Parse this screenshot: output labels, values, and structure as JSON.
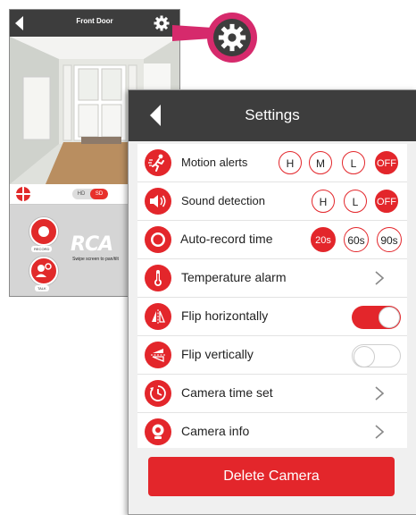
{
  "phone": {
    "title": "Front Door",
    "quality_hd": "HD",
    "quality_sd": "SD",
    "record_label": "RECORD",
    "talk_label": "TALK",
    "brand": "RCA",
    "swipe_hint": "Swipe screen to pan/tilt"
  },
  "settings": {
    "title": "Settings",
    "rows": [
      {
        "label": "Motion alerts",
        "icon": "running-person-icon",
        "options": [
          "H",
          "M",
          "L",
          "OFF"
        ],
        "selected": "OFF"
      },
      {
        "label": "Sound detection",
        "icon": "speaker-icon",
        "options": [
          "H",
          "L",
          "OFF"
        ],
        "selected": "OFF"
      },
      {
        "label": "Auto-record time",
        "icon": "record-icon",
        "options": [
          "20s",
          "60s",
          "90s"
        ],
        "selected": "20s"
      },
      {
        "label": "Temperature alarm",
        "icon": "thermometer-icon"
      },
      {
        "label": "Flip horizontally",
        "icon": "flip-horizontal-icon",
        "toggle": true
      },
      {
        "label": "Flip vertically",
        "icon": "flip-vertical-icon",
        "toggle": false
      },
      {
        "label": "Camera time set",
        "icon": "clock-icon"
      },
      {
        "label": "Camera info",
        "icon": "camera-info-icon"
      }
    ],
    "delete_label": "Delete Camera"
  },
  "colors": {
    "accent_red": "#e3262b",
    "header_dark": "#3d3d3d",
    "callout_pink": "#d62a6c"
  }
}
